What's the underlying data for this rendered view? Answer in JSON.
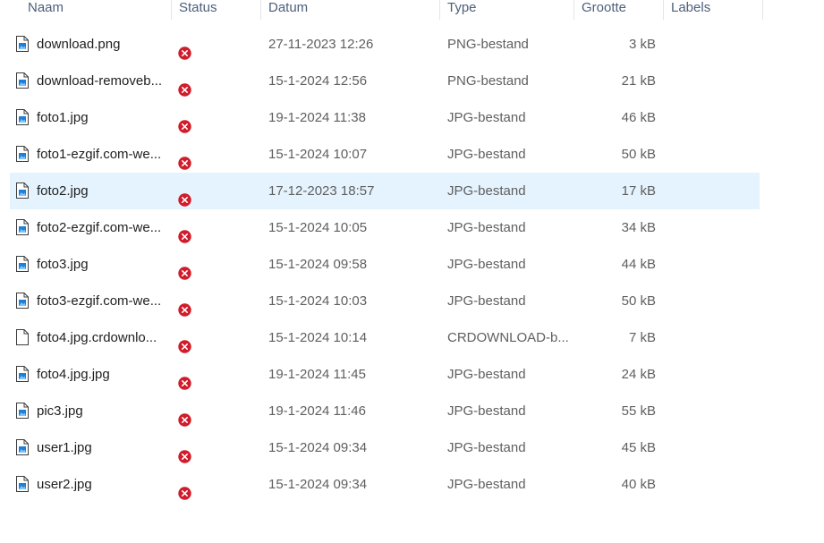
{
  "columns": {
    "name": "Naam",
    "status": "Status",
    "date": "Datum",
    "type": "Type",
    "size": "Grootte",
    "labels": "Labels"
  },
  "colors": {
    "selected_row": "#e5f3fe",
    "error_status": "#d01c2b",
    "header_text": "#4c607a"
  },
  "files": [
    {
      "name": "download.png",
      "icon": "image-file-icon",
      "status": "error-icon",
      "date": "27-11-2023 12:26",
      "type": "PNG-bestand",
      "size": "3 kB",
      "selected": false
    },
    {
      "name": "download-removeb...",
      "icon": "image-file-icon",
      "status": "error-icon",
      "date": "15-1-2024 12:56",
      "type": "PNG-bestand",
      "size": "21 kB",
      "selected": false
    },
    {
      "name": "foto1.jpg",
      "icon": "image-file-icon",
      "status": "error-icon",
      "date": "19-1-2024 11:38",
      "type": "JPG-bestand",
      "size": "46 kB",
      "selected": false
    },
    {
      "name": "foto1-ezgif.com-we...",
      "icon": "image-file-icon",
      "status": "error-icon",
      "date": "15-1-2024 10:07",
      "type": "JPG-bestand",
      "size": "50 kB",
      "selected": false
    },
    {
      "name": "foto2.jpg",
      "icon": "image-file-icon",
      "status": "error-icon",
      "date": "17-12-2023 18:57",
      "type": "JPG-bestand",
      "size": "17 kB",
      "selected": true
    },
    {
      "name": "foto2-ezgif.com-we...",
      "icon": "image-file-icon",
      "status": "error-icon",
      "date": "15-1-2024 10:05",
      "type": "JPG-bestand",
      "size": "34 kB",
      "selected": false
    },
    {
      "name": "foto3.jpg",
      "icon": "image-file-icon",
      "status": "error-icon",
      "date": "15-1-2024 09:58",
      "type": "JPG-bestand",
      "size": "44 kB",
      "selected": false
    },
    {
      "name": "foto3-ezgif.com-we...",
      "icon": "image-file-icon",
      "status": "error-icon",
      "date": "15-1-2024 10:03",
      "type": "JPG-bestand",
      "size": "50 kB",
      "selected": false
    },
    {
      "name": "foto4.jpg.crdownlo...",
      "icon": "blank-file-icon",
      "status": "error-icon",
      "date": "15-1-2024 10:14",
      "type": "CRDOWNLOAD-b...",
      "size": "7 kB",
      "selected": false
    },
    {
      "name": "foto4.jpg.jpg",
      "icon": "image-file-icon",
      "status": "error-icon",
      "date": "19-1-2024 11:45",
      "type": "JPG-bestand",
      "size": "24 kB",
      "selected": false
    },
    {
      "name": "pic3.jpg",
      "icon": "image-file-icon",
      "status": "error-icon",
      "date": "19-1-2024 11:46",
      "type": "JPG-bestand",
      "size": "55 kB",
      "selected": false
    },
    {
      "name": "user1.jpg",
      "icon": "image-file-icon",
      "status": "error-icon",
      "date": "15-1-2024 09:34",
      "type": "JPG-bestand",
      "size": "45 kB",
      "selected": false
    },
    {
      "name": "user2.jpg",
      "icon": "image-file-icon",
      "status": "error-icon",
      "date": "15-1-2024 09:34",
      "type": "JPG-bestand",
      "size": "40 kB",
      "selected": false
    }
  ]
}
